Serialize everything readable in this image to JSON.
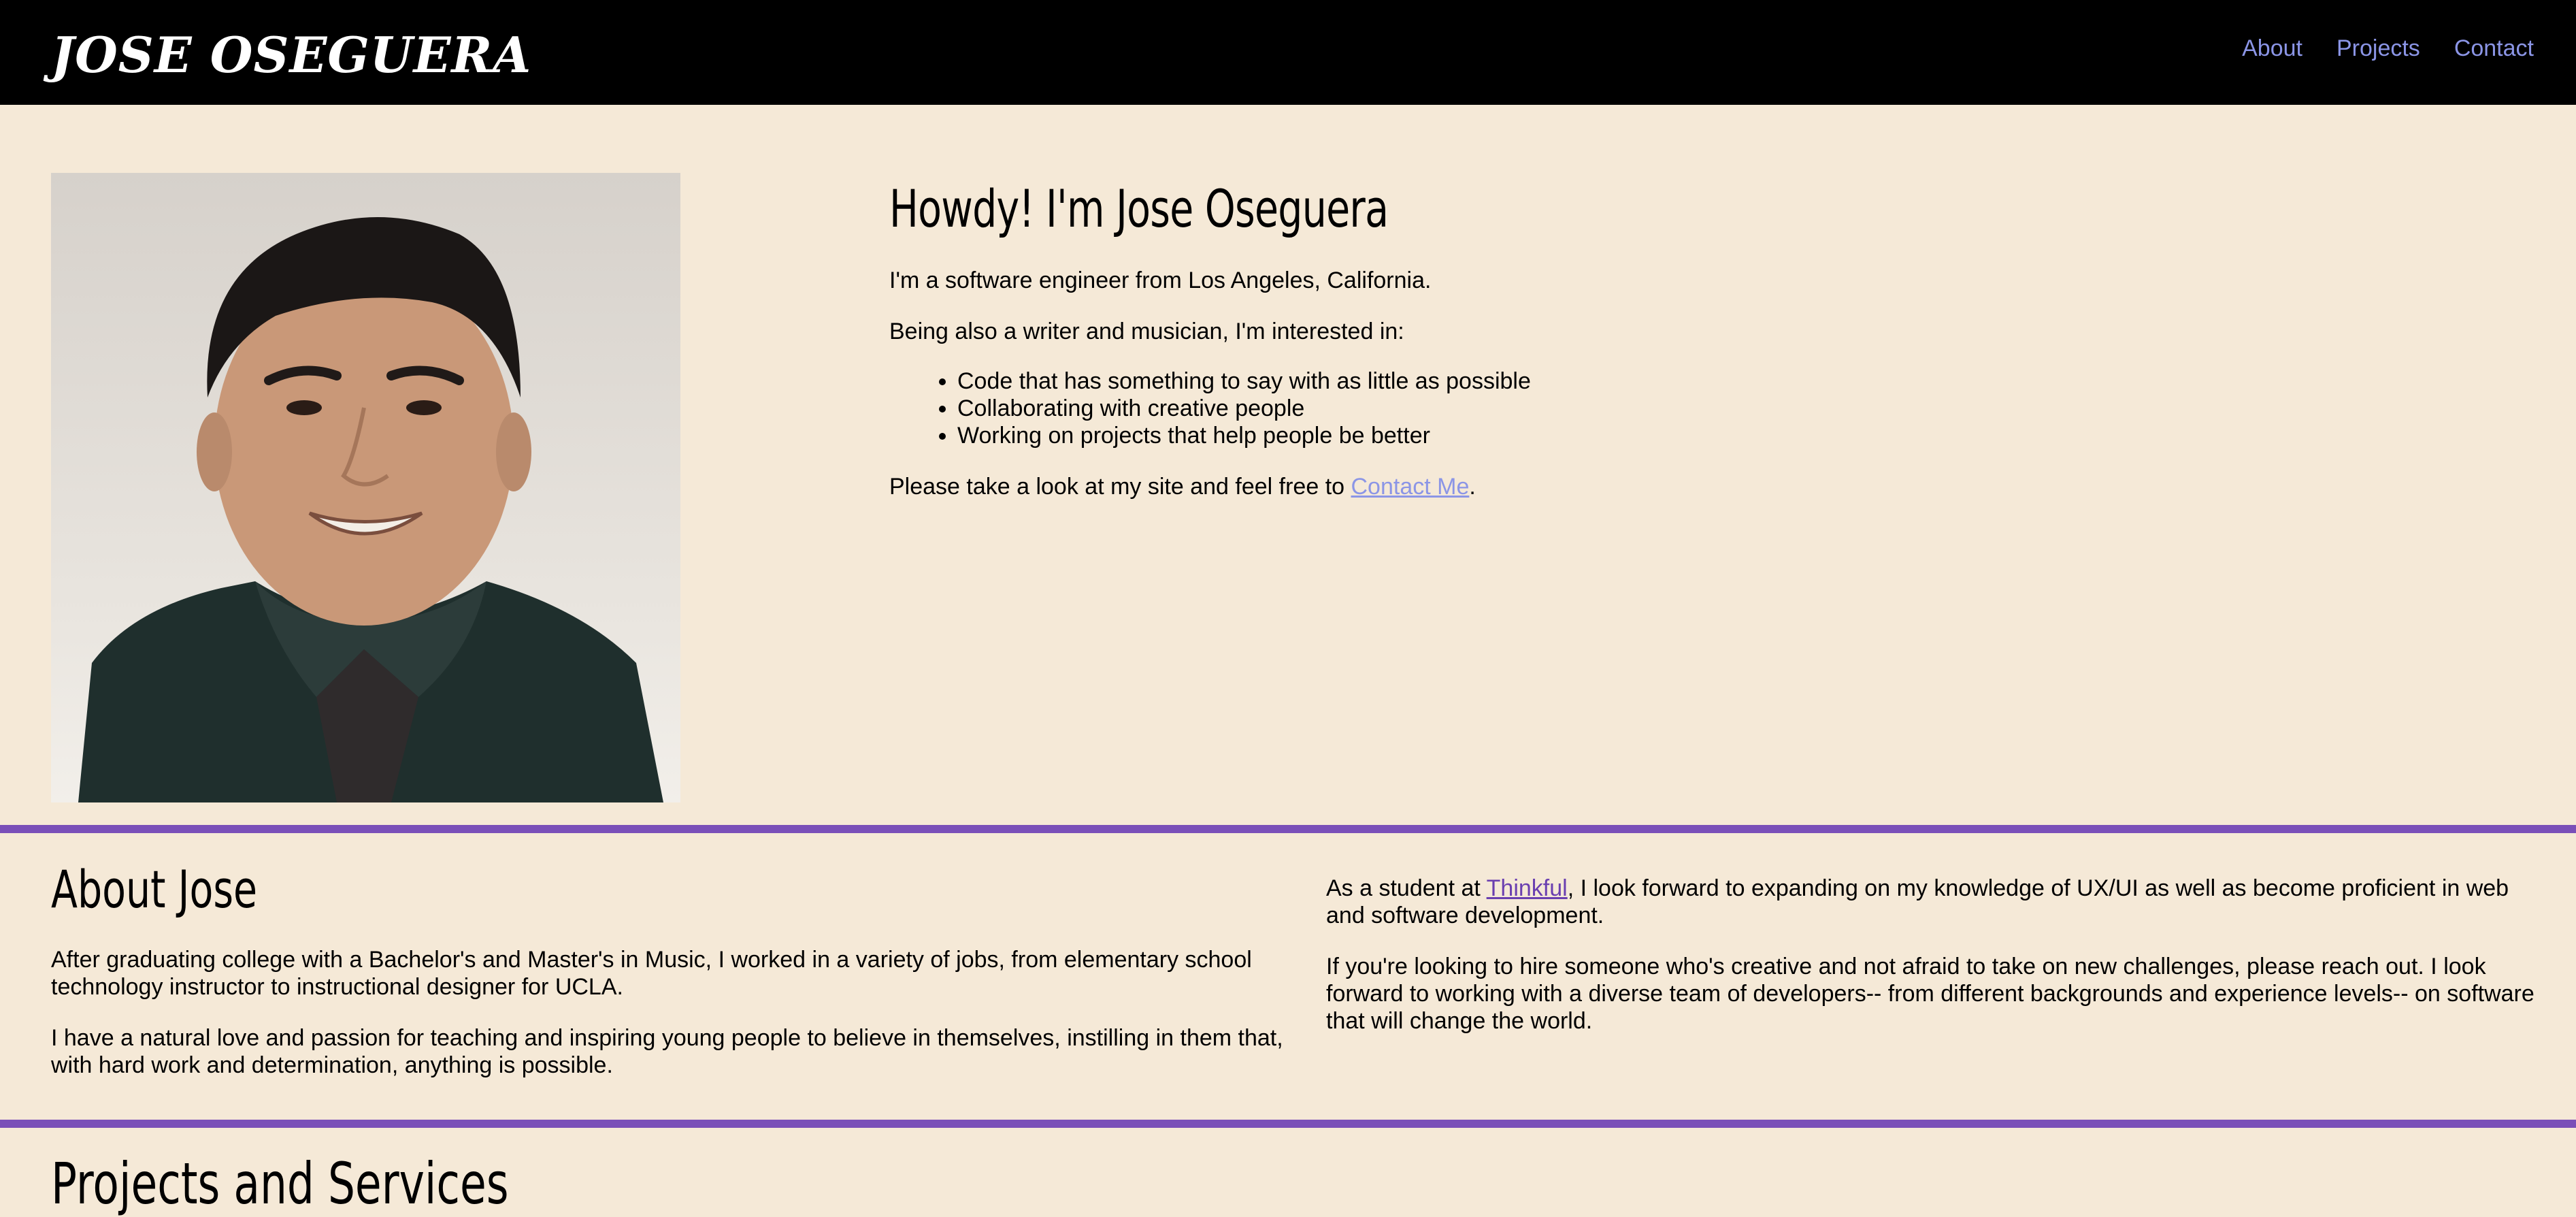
{
  "header": {
    "brand": "Jose Oseguera",
    "nav": [
      {
        "label": "About"
      },
      {
        "label": "Projects"
      },
      {
        "label": "Contact"
      }
    ]
  },
  "hero": {
    "title": "Howdy! I'm Jose Oseguera",
    "intro": "I'm a software engineer from Los Angeles, California.",
    "interests_intro": "Being also a writer and musician, I'm interested in:",
    "interests": [
      "Code that has something to say with as little as possible",
      "Collaborating with creative people",
      "Working on projects that help people be better"
    ],
    "cta_prefix": "Please take a look at my site and feel free to ",
    "cta_link": "Contact Me",
    "cta_suffix": "."
  },
  "about": {
    "title": "About Jose",
    "left_paragraphs": [
      "After graduating college with a Bachelor's and Master's in Music, I worked in a variety of jobs, from elementary school technology instructor to instructional designer for UCLA.",
      "I have a natural love and passion for teaching and inspiring young people to believe in themselves, instilling in them that, with hard work and determination, anything is possible."
    ],
    "right_p1_prefix": "As a student at ",
    "right_p1_link": "Thinkful",
    "right_p1_suffix": ", I look forward to expanding on my knowledge of UX/UI as well as become proficient in web and software development.",
    "right_p2": "If you're looking to hire someone who's creative and not afraid to take on new challenges, please reach out. I look forward to working with a diverse team of developers-- from different backgrounds and experience levels-- on software that will change the world."
  },
  "projects": {
    "title": "Projects and Services"
  },
  "colors": {
    "background": "#f5e9d7",
    "header": "#000000",
    "nav_link": "#8b95e6",
    "divider": "#7a4fb8"
  }
}
